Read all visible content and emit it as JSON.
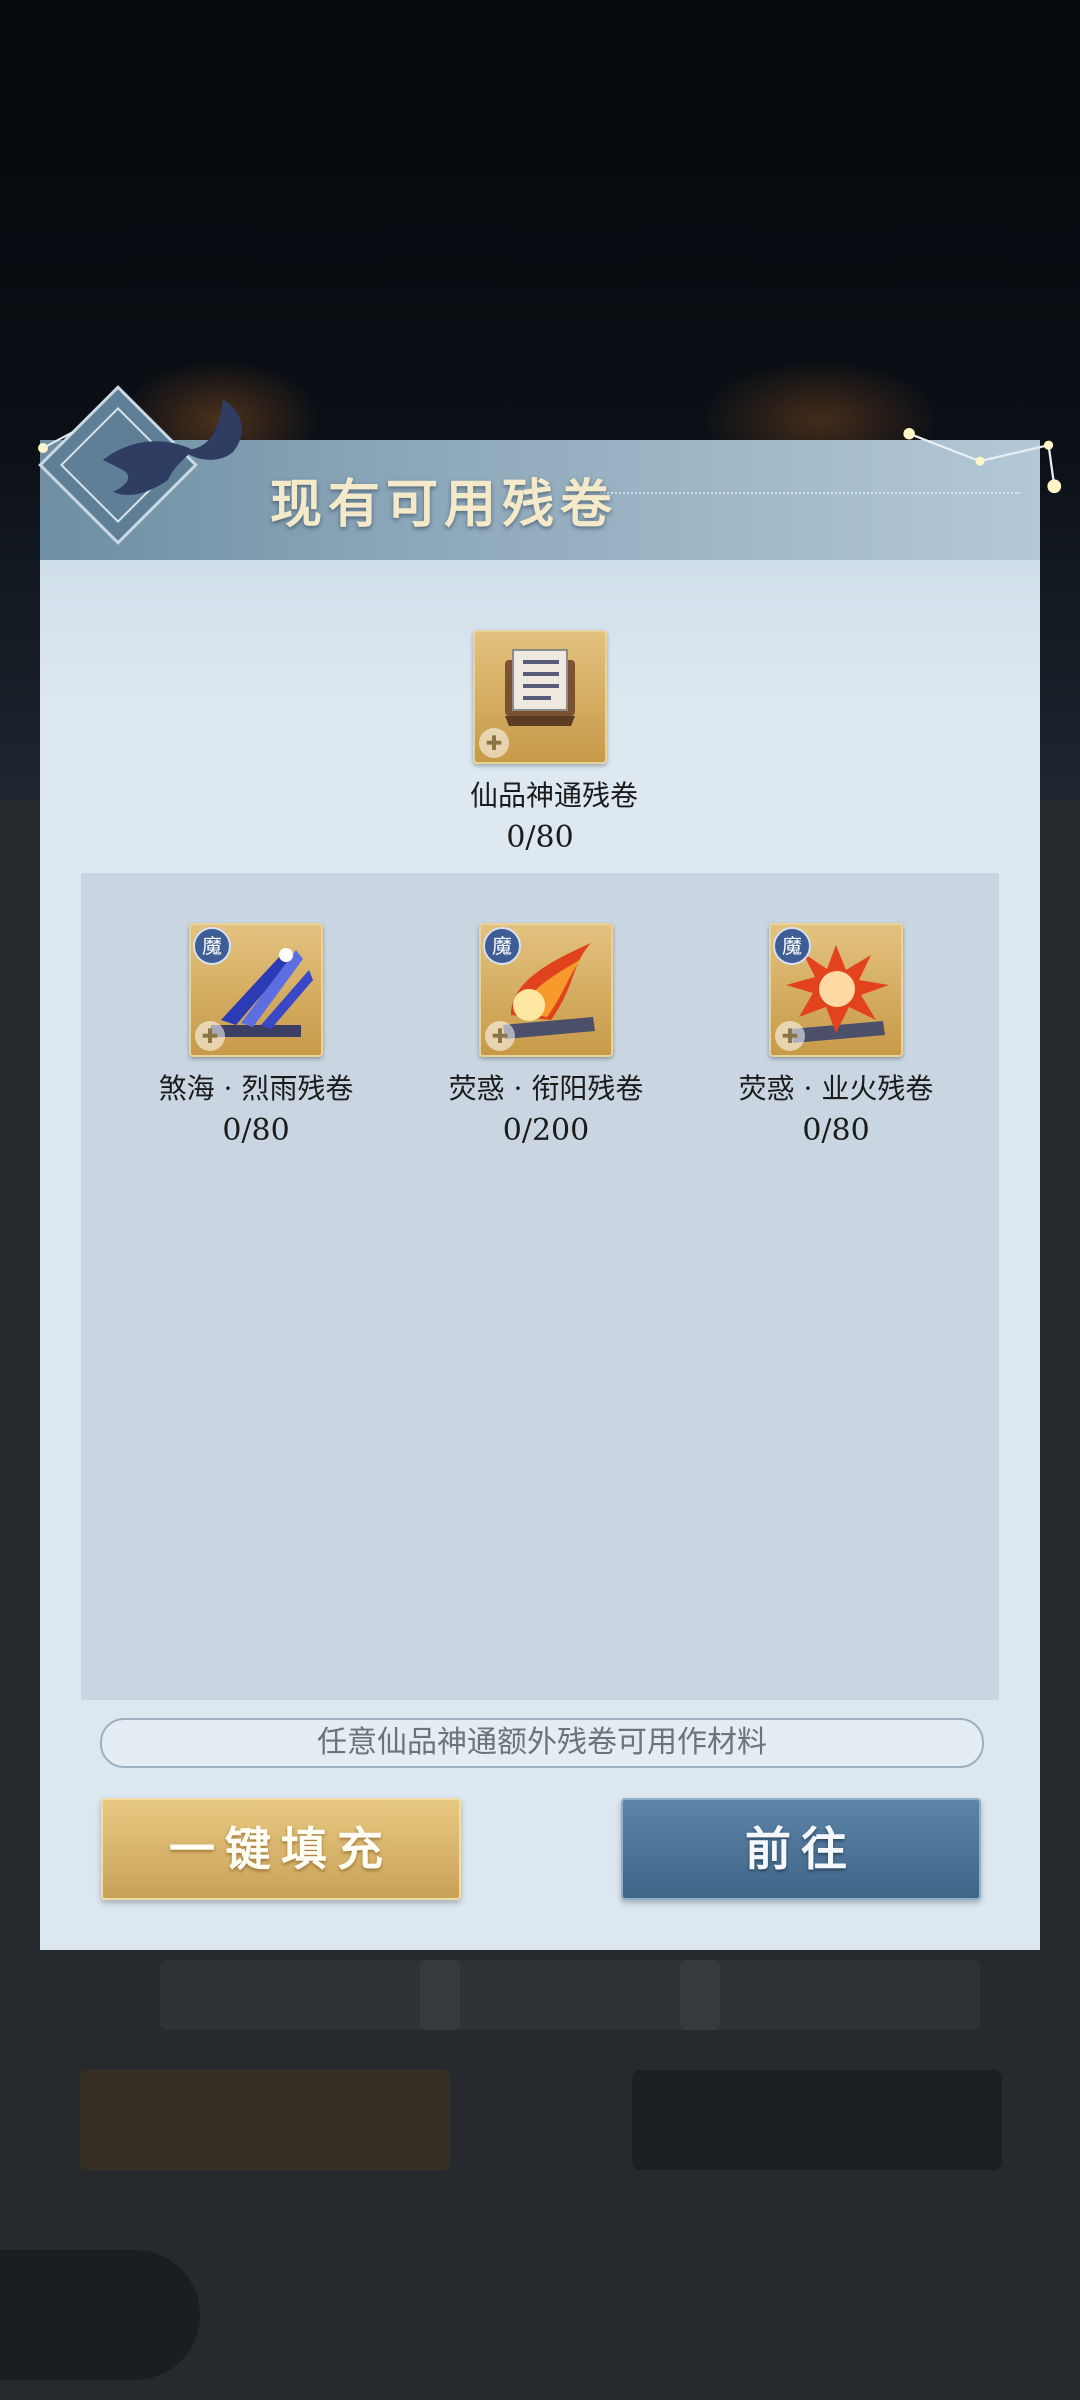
{
  "dialog": {
    "title": "现有可用残卷",
    "top_item": {
      "name": "仙品神通残卷",
      "count": "0/80",
      "icon": "scroll-book-icon"
    },
    "items": [
      {
        "name": "煞海 · 烈雨残卷",
        "count": "0/80",
        "badge": "魔",
        "icon": "blue-rain-scroll-icon"
      },
      {
        "name": "荧惑 · 衔阳残卷",
        "count": "0/200",
        "badge": "魔",
        "icon": "fire-sun-scroll-icon"
      },
      {
        "name": "荧惑 · 业火残卷",
        "count": "0/80",
        "badge": "魔",
        "icon": "karma-fire-scroll-icon"
      }
    ],
    "info_text": "任意仙品神通额外残卷可用作材料",
    "fill_button": "一键填充",
    "goto_button": "前往"
  },
  "colors": {
    "gold": "#c9a25a",
    "blue": "#4a7092",
    "badge": "#3e5d97"
  }
}
